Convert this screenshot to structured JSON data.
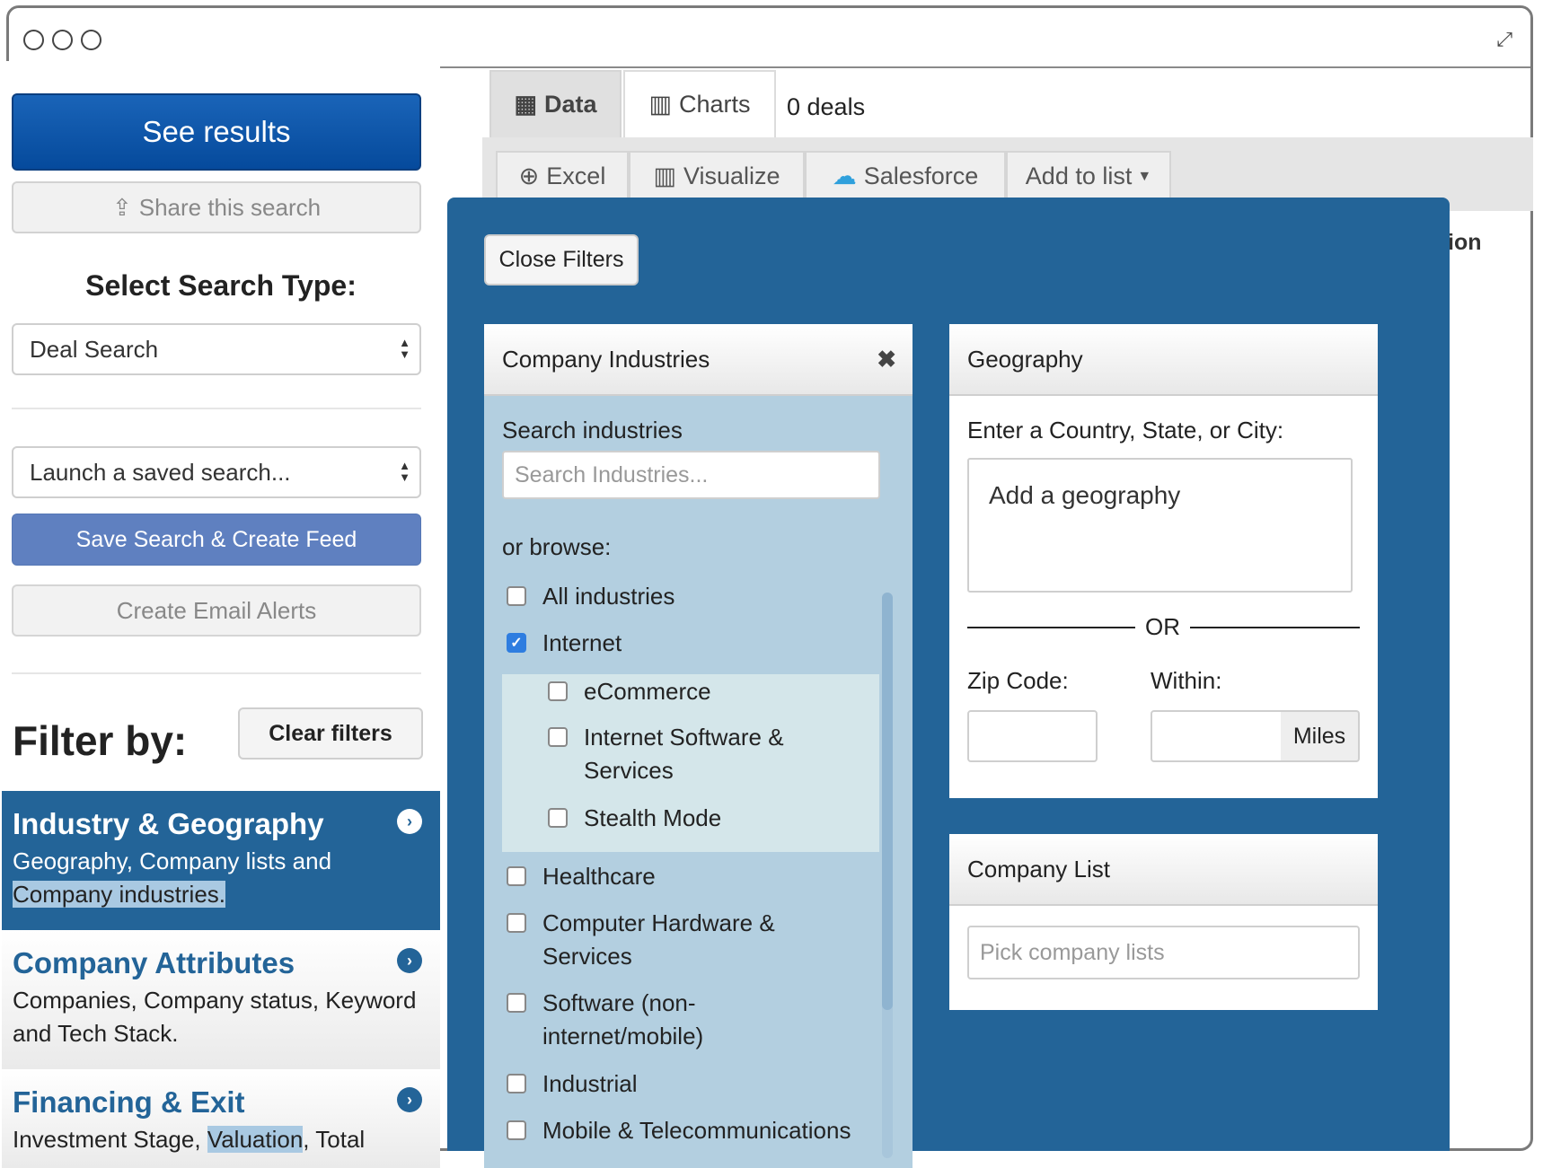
{
  "sidebar": {
    "see_results": "See results",
    "share": "Share this search",
    "select_type_label": "Select Search Type:",
    "search_type": "Deal Search",
    "saved_search": "Launch a saved search...",
    "save_feed": "Save Search & Create Feed",
    "email_alerts": "Create Email Alerts",
    "filter_by": "Filter by:",
    "clear_filters": "Clear filters",
    "sections": [
      {
        "title": "Industry & Geography",
        "desc_pre": "Geography, Company lists and ",
        "desc_hl": "Company industries",
        "desc_post": "."
      },
      {
        "title": "Company Attributes",
        "desc": "Companies, Company status, Keyword and Tech Stack."
      },
      {
        "title": "Financing & Exit",
        "desc_pre": "Investment Stage, ",
        "desc_hl": "Valuation",
        "desc_post": ", Total"
      }
    ]
  },
  "tabs": [
    {
      "label": "Data",
      "icon": "table-icon"
    },
    {
      "label": "Charts",
      "icon": "bar-chart-icon"
    }
  ],
  "deals_count": "0 deals",
  "toolbar": [
    {
      "label": "Excel",
      "icon": "download-icon"
    },
    {
      "label": "Visualize",
      "icon": "bar-chart-icon"
    },
    {
      "label": "Salesforce",
      "icon": "salesforce-cloud-icon"
    },
    {
      "label": "Add to list",
      "icon": "caret-down-icon"
    }
  ],
  "column_fragment": "ion",
  "filters": {
    "close": "Close Filters",
    "industries": {
      "title": "Company Industries",
      "search_label": "Search industries",
      "search_placeholder": "Search Industries...",
      "browse_label": "or browse:",
      "items": [
        {
          "label": "All industries",
          "checked": false
        },
        {
          "label": "Internet",
          "checked": true
        },
        {
          "label": "eCommerce",
          "checked": false
        },
        {
          "label": "Internet Software & Services",
          "checked": false
        },
        {
          "label": "Stealth Mode",
          "checked": false
        },
        {
          "label": "Healthcare",
          "checked": false
        },
        {
          "label": "Computer Hardware & Services",
          "checked": false
        },
        {
          "label": "Software (non-internet/mobile)",
          "checked": false
        },
        {
          "label": "Industrial",
          "checked": false
        },
        {
          "label": "Mobile & Telecommunications",
          "checked": false
        }
      ]
    },
    "geography": {
      "title": "Geography",
      "prompt": "Enter a Country, State, or City:",
      "placeholder": "Add a geography",
      "or": "OR",
      "zip_label": "Zip Code:",
      "within_label": "Within:",
      "units": "Miles"
    },
    "company_list": {
      "title": "Company List",
      "placeholder": "Pick company lists"
    }
  },
  "colors": {
    "brand_blue": "#236498",
    "see_results": "#0d57ad",
    "save_feed": "#5f80c0"
  }
}
